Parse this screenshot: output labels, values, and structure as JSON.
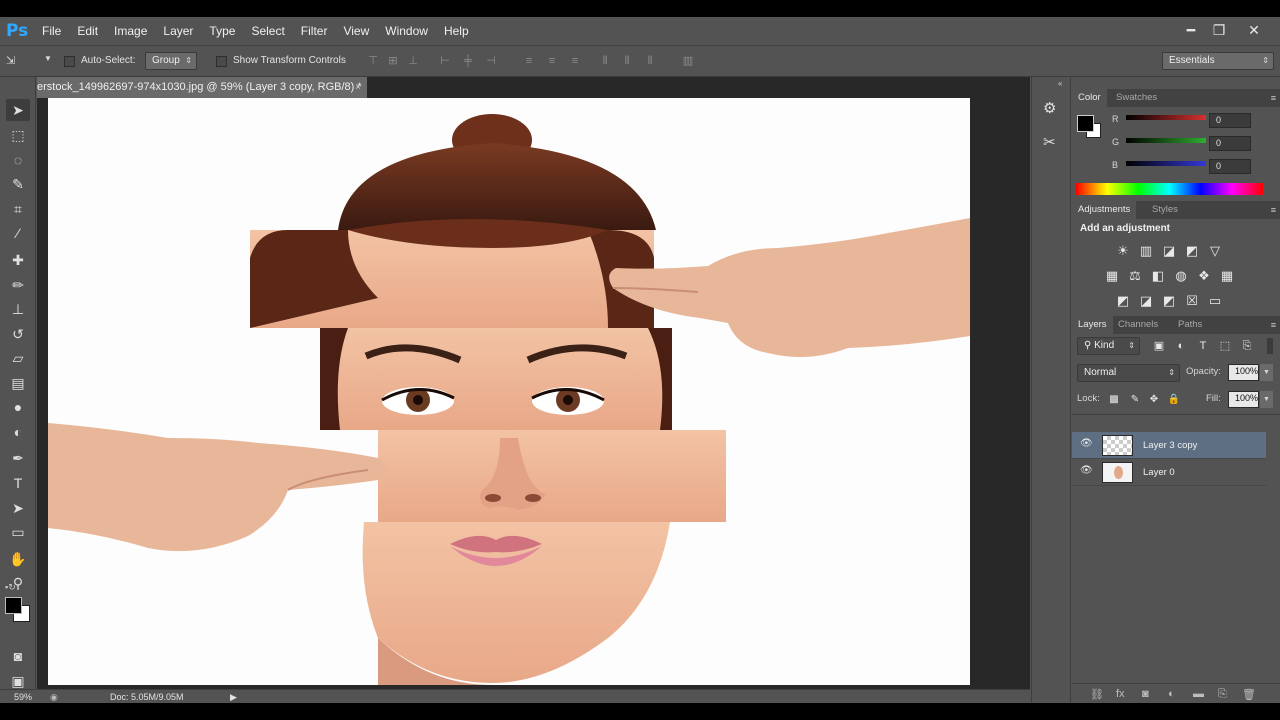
{
  "app": {
    "logo": "Ps"
  },
  "menu": [
    "File",
    "Edit",
    "Image",
    "Layer",
    "Type",
    "Select",
    "Filter",
    "View",
    "Window",
    "Help"
  ],
  "window_controls": {
    "minimize": "━",
    "restore": "❐",
    "close": "✕"
  },
  "options_bar": {
    "auto_select_label": "Auto-Select:",
    "auto_select_value": "Group",
    "show_transform_label": "Show Transform Controls",
    "workspace": "Essentials"
  },
  "document": {
    "tab_title": "erstock_149962697-974x1030.jpg @ 59% (Layer 3 copy, RGB/8) *",
    "close": "×"
  },
  "status": {
    "zoom": "59%",
    "doc_size": "Doc: 5.05M/9.05M"
  },
  "color_panel": {
    "tabs": [
      "Color",
      "Swatches"
    ],
    "channels": [
      {
        "label": "R",
        "value": "0",
        "color": "#d83030"
      },
      {
        "label": "G",
        "value": "0",
        "color": "#2fae2f"
      },
      {
        "label": "B",
        "value": "0",
        "color": "#3338d8"
      }
    ]
  },
  "adjustments_panel": {
    "tabs": [
      "Adjustments",
      "Styles"
    ],
    "heading": "Add an adjustment"
  },
  "layers_panel": {
    "tabs": [
      "Layers",
      "Channels",
      "Paths"
    ],
    "filter": "Kind",
    "blend_mode": "Normal",
    "opacity_label": "Opacity:",
    "opacity": "100%",
    "lock_label": "Lock:",
    "fill_label": "Fill:",
    "fill": "100%",
    "layers": [
      {
        "name": "Layer 3 copy",
        "selected": true
      },
      {
        "name": "Layer 0",
        "selected": false
      }
    ]
  },
  "colors": {
    "accent": "#31a8ff",
    "selection": "#5e6f84",
    "panel_bg": "#535353"
  }
}
